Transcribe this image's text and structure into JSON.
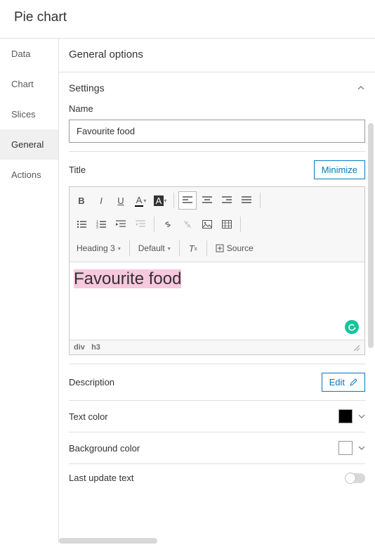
{
  "header": {
    "title": "Pie chart"
  },
  "sidebar": {
    "items": [
      {
        "label": "Data"
      },
      {
        "label": "Chart"
      },
      {
        "label": "Slices"
      },
      {
        "label": "General"
      },
      {
        "label": "Actions"
      }
    ],
    "activeIndex": 3
  },
  "section": {
    "title": "General options"
  },
  "settings": {
    "header": "Settings",
    "name_label": "Name",
    "name_value": "Favourite food",
    "title_label": "Title",
    "minimize_label": "Minimize",
    "title_value": "Favourite food",
    "desc_label": "Description",
    "edit_label": "Edit",
    "text_color_label": "Text color",
    "text_color_value": "#000000",
    "bg_color_label": "Background color",
    "bg_color_value": "#ffffff",
    "last_update_label": "Last update text"
  },
  "editor": {
    "dropdowns": {
      "heading": "Heading 3",
      "style": "Default",
      "source": "Source"
    },
    "path": [
      "div",
      "h3"
    ]
  }
}
